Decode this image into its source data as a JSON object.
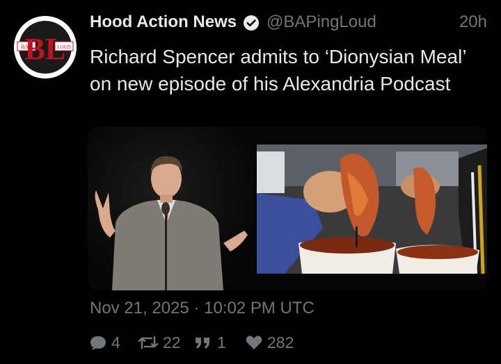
{
  "author": {
    "display_name": "Hood Action News",
    "handle": "@BAPingLoud",
    "verified": true,
    "avatar": {
      "logo_letters": "BL",
      "left_tag": "BAP",
      "right_tag": "LOUD",
      "icon": "bap-logo-avatar"
    }
  },
  "tweet": {
    "time_ago": "20h",
    "text": "Richard Spencer admits to ‘Dionysian Meal’ on new episode of his Alexandria Podcast",
    "timestamp": "Nov 21, 2025 · 10:02 PM UTC"
  },
  "media": [
    {
      "icon": "photo-man-at-microphone"
    },
    {
      "icon": "photo-birria-tacos-consomme"
    }
  ],
  "stats": {
    "replies": "4",
    "retweets": "22",
    "quotes": "1",
    "likes": "282"
  },
  "colors": {
    "background": "#000000",
    "text": "#e7e9ea",
    "muted": "#71767b",
    "logo_red": "#c1121f"
  }
}
